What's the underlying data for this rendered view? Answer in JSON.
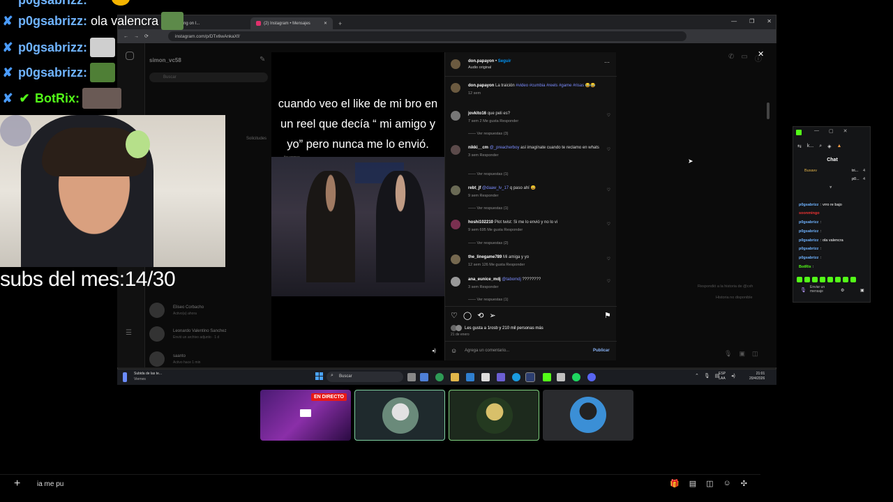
{
  "overlay_chat": [
    {
      "user": "p0gsabrizz",
      "message": "ola valencra",
      "has_emote": true
    },
    {
      "user": "p0gsabrizz",
      "message": "",
      "has_emote": true
    },
    {
      "user": "p0gsabrizz",
      "message": "",
      "has_emote": true
    },
    {
      "user": "BotRix",
      "message": "",
      "has_emote": true
    }
  ],
  "subs_text": "subs del mes:14/30",
  "browser": {
    "tabs": [
      {
        "label": "...ng on I..."
      },
      {
        "label": "(2) Instagram • Mensajes"
      }
    ],
    "url": "instagram.com/p/DTx6wAnkaXf/"
  },
  "instagram": {
    "account_name": "simon_vc58",
    "search_placeholder": "Buscar",
    "requests_label": "Solicitudes",
    "dm_list": [
      {
        "name": "Eliseo Corbacho",
        "sub": "Activo(a) ahora"
      },
      {
        "name": "Leonardo Valentino Sanchez",
        "sub": "Envió un archivo adjunto · 1 d"
      },
      {
        "name": "saanto",
        "sub": "Activo hace 1 min"
      }
    ],
    "right_hint_1": "Respondió a la historia de @cxh",
    "right_hint_2": "Historia no disponible"
  },
  "reel": {
    "caption": "cuando veo el like de mi bro en un reel que decía “ mi amigo y yo” pero nunca me lo envió.",
    "watermark": "Bro.papayon"
  },
  "post": {
    "author": "don.papayon",
    "follow_label": "Seguir",
    "audio_label": "Audio original",
    "description_user": "don.papayon",
    "description_text": "La traición",
    "hashtags": "#video #cumbia #reels #game #risas",
    "description_time": "12 sem",
    "comments": [
      {
        "user": "jovkito16",
        "text": "que peli es?",
        "meta": "7 sem   2 Me gusta   Responder",
        "replies": "Ver respuestas (3)"
      },
      {
        "user": "nikki__cm",
        "mention": "@_preacherboy",
        "text": "así imagínate cuando te reclamo en whats",
        "meta": "3 sem   Responder",
        "replies": "Ver respuestas (1)"
      },
      {
        "user": "rebt_jf",
        "mention": "@daaw_lv_17",
        "text": "q paso ahí 😀",
        "meta": "9 sem   Responder",
        "replies": "Ver respuestas (1)"
      },
      {
        "user": "hoshi102210",
        "text": "Plot twist: Si me lo envió y no lo vi",
        "meta": "9 sem   695 Me gusta   Responder",
        "replies": "Ver respuestas (2)"
      },
      {
        "user": "the_linegame789",
        "text": "Mi amiga y yo",
        "meta": "12 sem   126 Me gusta   Responder",
        "replies": ""
      },
      {
        "user": "ana_eunice_mdj",
        "mention": "@tabomdj",
        "text": "????????",
        "meta": "3 sem   Responder",
        "replies": "Ver respuestas (1)"
      }
    ],
    "likes_text": "Les gusta a 1rosb y 210 mil personas más",
    "date_text": "21 de enero",
    "comment_placeholder": "Agrega un comentario...",
    "publish_label": "Publicar"
  },
  "kick_chat": {
    "title": "Chat",
    "header_icons": "k...",
    "pinned": [
      {
        "user": "Buxavv",
        "text": "tri...",
        "count": "4"
      },
      {
        "user": "",
        "text": "p0...",
        "count": "4"
      }
    ],
    "messages": [
      {
        "user": "p0gsabrizz",
        "text": "vrro re bajo"
      },
      {
        "user": "soonmingo",
        "text": ""
      },
      {
        "user": "p0gsabrizz",
        "text": ""
      },
      {
        "user": "p0gsabrizz",
        "text": ""
      },
      {
        "user": "p0gsabrizz",
        "text": "ola valencra"
      },
      {
        "user": "p0gsabrizz",
        "text": ""
      },
      {
        "user": "p0gsabrizz",
        "text": ""
      },
      {
        "user": "BotRix",
        "text": ""
      }
    ],
    "send_label": "Enviar un mensaje"
  },
  "taskbar": {
    "notification_title": "Subida de las te...",
    "notification_sub": "Viernes",
    "search_placeholder": "Buscar",
    "lang_top": "ESP",
    "lang_bottom": "LAA",
    "time": "21:01",
    "date": "20/4/2026"
  },
  "cards": [
    {
      "label": "EN DIRECTO"
    }
  ],
  "input_text": "ia me pu",
  "colors": {
    "accent": "#0095f6",
    "kick_green": "#53fc18",
    "live_red": "#e91916"
  }
}
